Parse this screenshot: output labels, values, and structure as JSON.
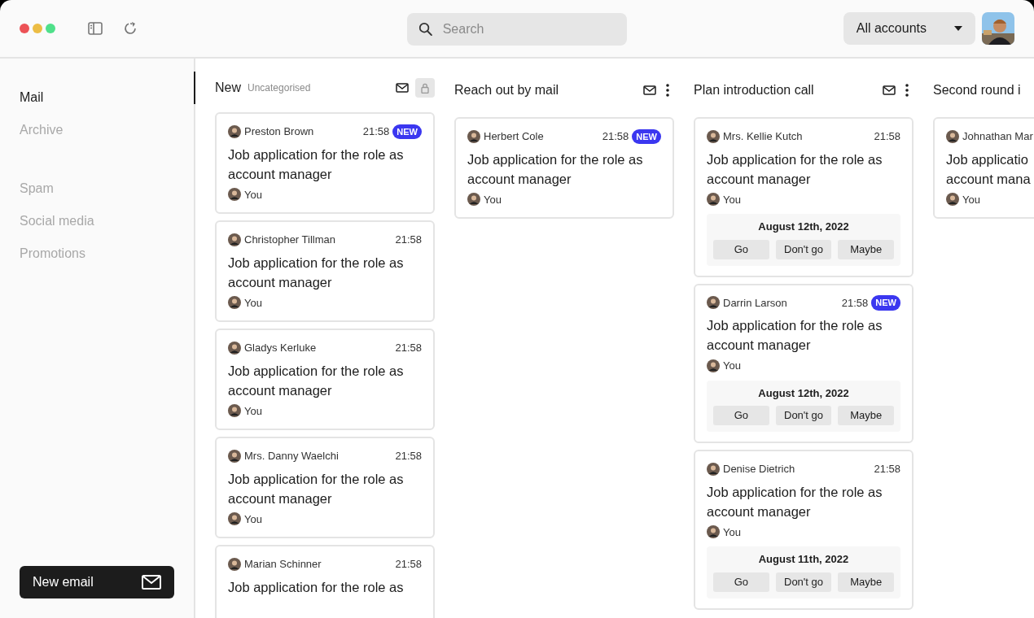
{
  "toolbar": {
    "search": {
      "placeholder": "Search"
    },
    "account_select": "All accounts"
  },
  "sidebar": {
    "groups": [
      [
        {
          "label": "Mail",
          "selected": true
        },
        {
          "label": "Archive",
          "selected": false
        }
      ],
      [
        {
          "label": "Spam",
          "selected": false
        },
        {
          "label": "Social media",
          "selected": false
        },
        {
          "label": "Promotions",
          "selected": false
        }
      ]
    ],
    "new_email": "New email"
  },
  "columns": [
    {
      "title": "New",
      "subtitle": "Uncategorised",
      "locked": true,
      "cards": [
        {
          "sender": "Preston Brown",
          "time": "21:58",
          "badge": "NEW",
          "subject": "Job application for the role as\naccount manager",
          "from": "You"
        },
        {
          "sender": "Christopher Tillman",
          "time": "21:58",
          "subject": "Job application for the role as\naccount manager",
          "from": "You"
        },
        {
          "sender": "Gladys Kerluke",
          "time": "21:58",
          "subject": "Job application for the role as\naccount manager",
          "from": "You"
        },
        {
          "sender": "Mrs. Danny Waelchi",
          "time": "21:58",
          "subject": "Job application for the role as\naccount manager",
          "from": "You"
        },
        {
          "sender": "Marian Schinner",
          "time": "21:58",
          "subject": "Job application for the role as"
        }
      ]
    },
    {
      "title": "Reach out by mail",
      "locked": false,
      "cards": [
        {
          "sender": "Herbert Cole",
          "time": "21:58",
          "badge": "NEW",
          "subject": "Job application for the role as\naccount manager",
          "from": "You"
        }
      ]
    },
    {
      "title": "Plan introduction call",
      "locked": false,
      "cards": [
        {
          "sender": "Mrs. Kellie Kutch",
          "time": "21:58",
          "subject": "Job application for the role as\naccount manager",
          "from": "You",
          "event": {
            "date": "August 12th, 2022",
            "options": [
              "Go",
              "Don't go",
              "Maybe"
            ]
          }
        },
        {
          "sender": "Darrin Larson",
          "time": "21:58",
          "badge": "NEW",
          "subject": "Job application for the role as\naccount manager",
          "from": "You",
          "event": {
            "date": "August 12th, 2022",
            "options": [
              "Go",
              "Don't go",
              "Maybe"
            ]
          }
        },
        {
          "sender": "Denise Dietrich",
          "time": "21:58",
          "subject": "Job application for the role as\naccount manager",
          "from": "You",
          "event": {
            "date": "August 11th, 2022",
            "options": [
              "Go",
              "Don't go",
              "Maybe"
            ]
          }
        }
      ]
    },
    {
      "title": "Second round i",
      "cards": [
        {
          "sender": "Johnathan Mar",
          "subject": "Job applicatio\naccount mana",
          "from": "You"
        }
      ]
    }
  ]
}
